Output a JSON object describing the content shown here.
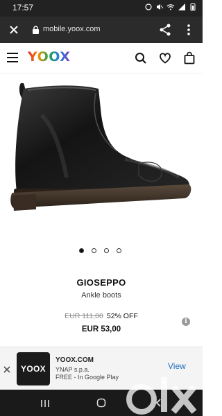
{
  "status_bar": {
    "time": "17:57"
  },
  "browser": {
    "url": "mobile.yoox.com"
  },
  "site": {
    "logo": "YOOX"
  },
  "product": {
    "brand": "GIOSEPPO",
    "category": "Ankle boots",
    "old_price": "EUR 111,00",
    "discount": "52% OFF",
    "price": "EUR 53,00",
    "image_count": 4,
    "active_image": 1
  },
  "app_banner": {
    "logo_text": "YOOX",
    "title": "YOOX.COM",
    "publisher": "YNAP s.p.a.",
    "availability": "FREE - In Google Play",
    "view_label": "View"
  },
  "colors": {
    "status_bar": "#222222",
    "browser_bar": "#2b2b2b",
    "view_link": "#1f6fbf",
    "nav_bar": "#1a1a1a"
  }
}
